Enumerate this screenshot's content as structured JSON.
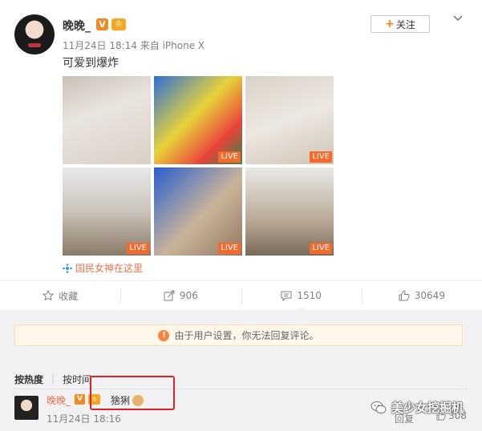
{
  "post": {
    "username": "晚晚_",
    "badge_v": "V",
    "badge_crown": "♔",
    "meta": "11月24日 18:14 来自 iPhone X",
    "follow_label": "关注",
    "text": "可爱到爆炸",
    "images": [
      {
        "live": ""
      },
      {
        "live": "LIVE"
      },
      {
        "live": "LIVE"
      },
      {
        "live": "LIVE"
      },
      {
        "live": "LIVE"
      },
      {
        "live": "LIVE"
      }
    ],
    "location": "国民女神在这里"
  },
  "actions": {
    "favorite": "收藏",
    "repost": "906",
    "comment": "1510",
    "like": "30649"
  },
  "comments": {
    "notice": "由于用户设置，你无法回复评论。",
    "sort_hot": "按热度",
    "sort_time": "按时间",
    "first": {
      "name": "晚晚_",
      "badge_v": "V",
      "badge_crown": "♔",
      "text": "猞猁",
      "time": "11月24日 18:16",
      "reply": "回复",
      "likes": "308"
    }
  },
  "watermark": "美少女挖掘机",
  "colors": {
    "accent": "#eb7350",
    "follow_plus": "#ff8200",
    "live": "#f56a2b",
    "highlight": "#d8232a"
  }
}
